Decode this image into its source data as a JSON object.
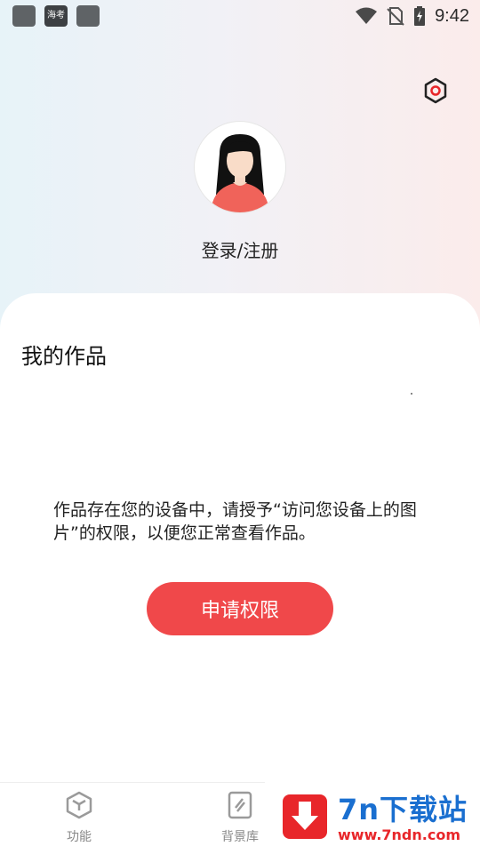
{
  "status_bar": {
    "time": "9:42",
    "app_icon_text": "海考",
    "icons": [
      "wifi-icon",
      "no-sim-icon",
      "battery-charging-icon"
    ]
  },
  "header": {
    "settings_icon": "settings-icon",
    "login_label": "登录/注册"
  },
  "works": {
    "title": "我的作品",
    "permission_message": "作品存在您的设备中，请授予“访问您设备上的图片”的权限，以便您正常查看作品。",
    "permission_button": "申请权限"
  },
  "bottom_nav": {
    "items": [
      {
        "label": "功能",
        "icon": "cube-icon"
      },
      {
        "label": "背景库",
        "icon": "background-library-icon"
      }
    ]
  },
  "watermark": {
    "title": "7n下载站",
    "url": "www.7ndn.com"
  },
  "colors": {
    "accent": "#f0484a",
    "text": "#222222",
    "muted": "#888888"
  }
}
